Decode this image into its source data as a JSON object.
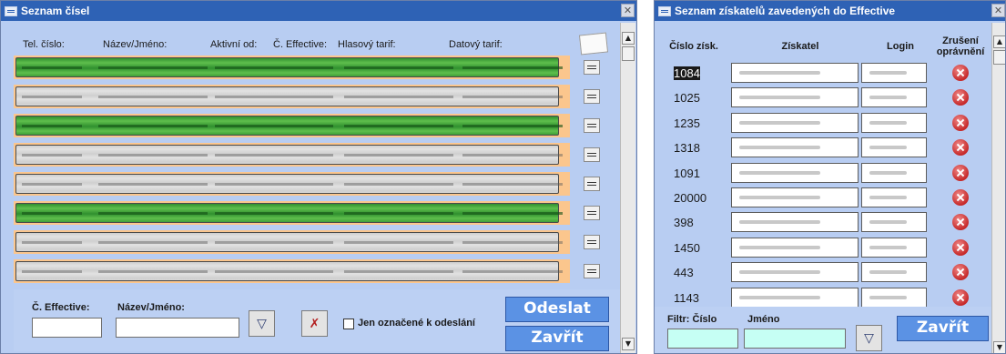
{
  "list_window": {
    "title": "Seznam čísel",
    "close_glyph": "✕",
    "columns": [
      "Tel. číslo:",
      "Název/Jméno:",
      "Aktivní od:",
      "Č. Effective:",
      "Hlasový tarif:",
      "Datový tarif:"
    ],
    "rows": [
      {
        "state": "green"
      },
      {
        "state": "gray"
      },
      {
        "state": "green"
      },
      {
        "state": "gray"
      },
      {
        "state": "gray"
      },
      {
        "state": "green"
      },
      {
        "state": "gray"
      },
      {
        "state": "gray"
      }
    ],
    "footer": {
      "effective_label": "Č. Effective:",
      "effective_value": "",
      "name_label": "Název/Jméno:",
      "name_value": "",
      "filter_icon": "filter-icon",
      "clear_filter_icon": "clear-filter-icon",
      "only_marked_label": "Jen označené k odeslání",
      "only_marked_checked": false,
      "send_label": "Odeslat",
      "close_label": "Zavřít"
    }
  },
  "recipients_window": {
    "title": "Seznam získatelů zavedených do Effective",
    "close_glyph": "✕",
    "columns": [
      "Číslo získ.",
      "Získatel",
      "Login",
      "Zrušení oprávnění"
    ],
    "rows": [
      {
        "number": "1084",
        "selected": true
      },
      {
        "number": "1025"
      },
      {
        "number": "1235"
      },
      {
        "number": "1318"
      },
      {
        "number": "1091"
      },
      {
        "number": "20000"
      },
      {
        "number": "398"
      },
      {
        "number": "1450"
      },
      {
        "number": "443"
      },
      {
        "number": "1143"
      }
    ],
    "footer": {
      "filter_number_label": "Filtr: Číslo",
      "filter_number_value": "",
      "name_label": "Jméno",
      "name_value": "",
      "filter_icon": "filter-icon",
      "close_label": "Zavřít"
    }
  },
  "colors": {
    "titlebar": "#2e62b5",
    "window_bg": "#b8cdf2",
    "row_active": "#3f9f3a",
    "row_inactive": "#d6d6d6",
    "row_border": "#fbc68d",
    "action_button": "#5b92e4",
    "filter_field": "#c6fff4",
    "revoke_icon": "#c62828"
  }
}
